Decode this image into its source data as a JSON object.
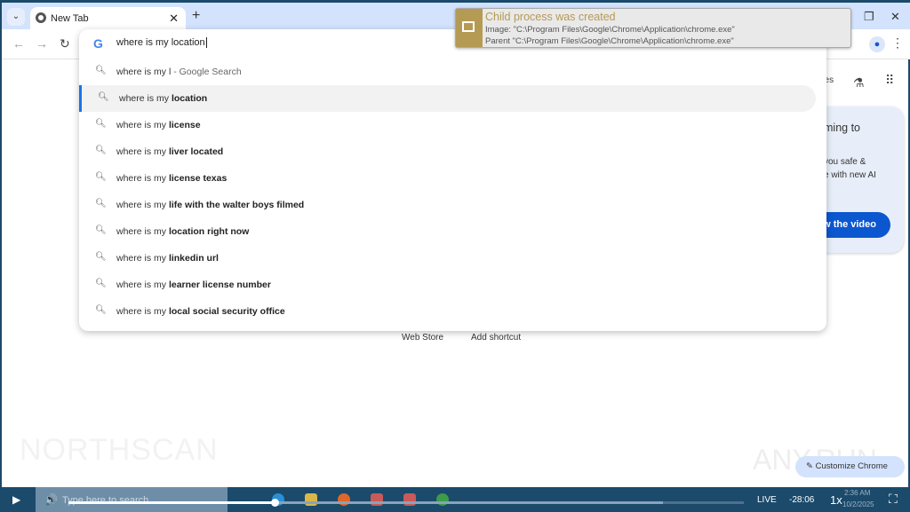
{
  "browser": {
    "tab_title": "New Tab",
    "omnibox_value": "where is my location"
  },
  "suggestions": [
    {
      "prefix": "where is my ",
      "bold": "l",
      "suffix": " - Google Search",
      "plain": true
    },
    {
      "prefix": "where is my ",
      "bold": "location"
    },
    {
      "prefix": "where is my ",
      "bold": "license"
    },
    {
      "prefix": "where is my ",
      "bold": "liver located"
    },
    {
      "prefix": "where is my ",
      "bold": "license texas"
    },
    {
      "prefix": "where is my ",
      "bold": "life with the walter boys filmed"
    },
    {
      "prefix": "where is my ",
      "bold": "location right now"
    },
    {
      "prefix": "where is my ",
      "bold": "linkedin url"
    },
    {
      "prefix": "where is my ",
      "bold": "learner license number"
    },
    {
      "prefix": "where is my ",
      "bold": "local social security office"
    }
  ],
  "notification": {
    "title": "Child process was created",
    "image": "Image: \"C:\\Program Files\\Google\\Chrome\\Application\\chrome.exe\"",
    "parent": "Parent \"C:\\Program Files\\Google\\Chrome\\Application\\chrome.exe\""
  },
  "page": {
    "images_link": "ges",
    "card_line1": "ming to",
    "card_line2": "you safe &",
    "card_line3": "e with new AI",
    "card_button": "w the video",
    "web_store": "Web Store",
    "add_shortcut": "Add shortcut",
    "customize": "Customize Chrome",
    "watermark_left": "NORTHSCAN",
    "watermark_right": "ANY.RUN"
  },
  "player": {
    "search_placeholder": "Type here to search",
    "live": "LIVE",
    "remaining": "-28:06",
    "speed": "1x",
    "time": "2:36 AM",
    "date": "10/2/2025",
    "progress_percent": 30.5,
    "buffered_percent": 88
  }
}
